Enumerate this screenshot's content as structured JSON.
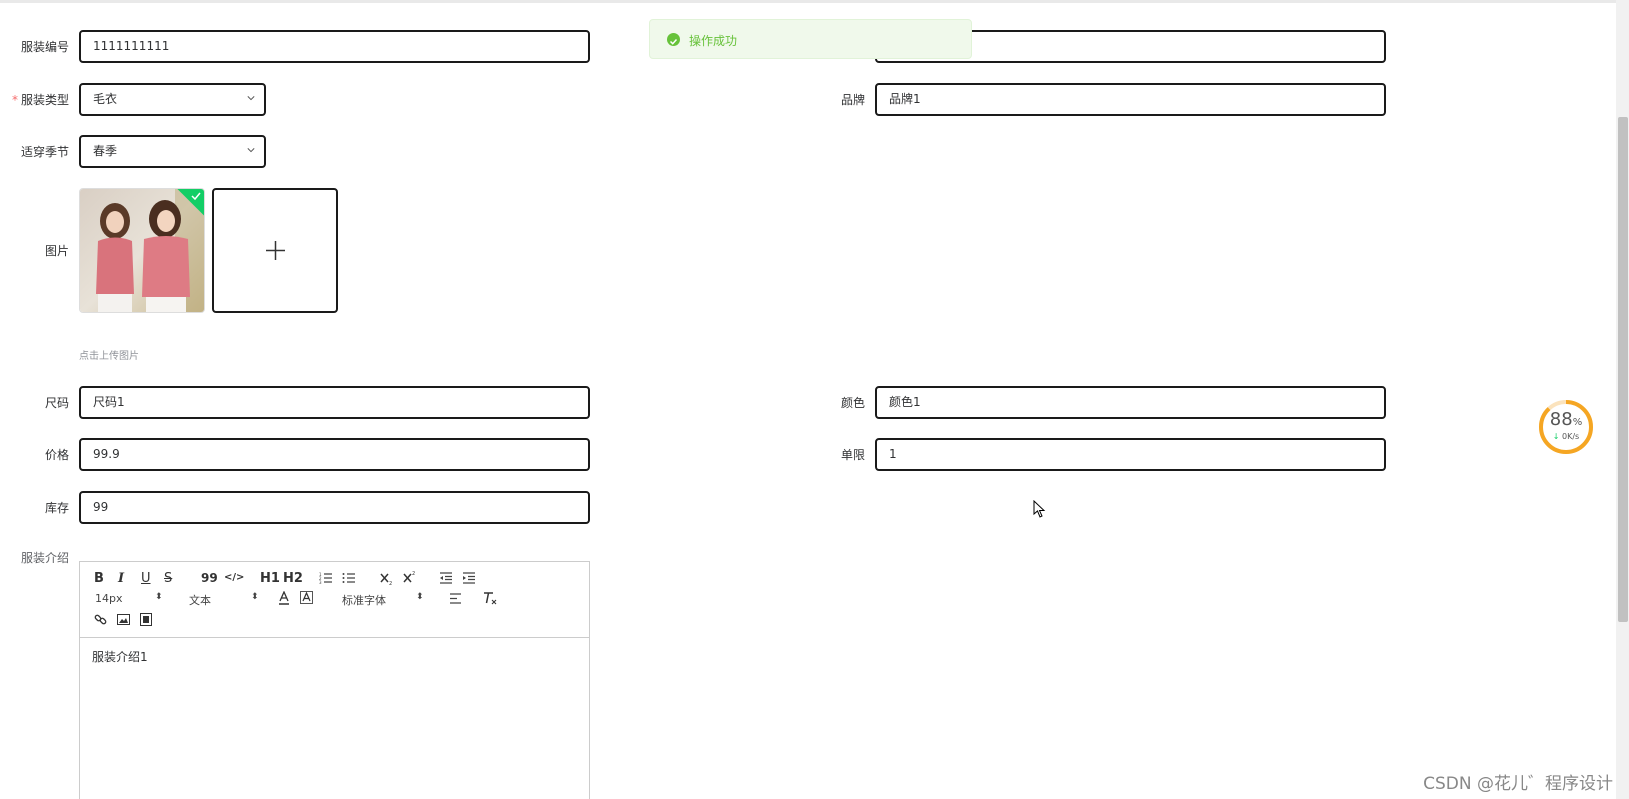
{
  "notification": {
    "message": "操作成功"
  },
  "form": {
    "garment_code": {
      "label": "服装编号",
      "value": "1111111111"
    },
    "garment_name": {
      "value": ""
    },
    "garment_type": {
      "label": "服装类型",
      "required_mark": "*",
      "value": "毛衣"
    },
    "brand": {
      "label": "品牌",
      "value": "品牌1"
    },
    "season": {
      "label": "适穿季节",
      "value": "春季"
    },
    "image": {
      "label": "图片",
      "upload_tip": "点击上传图片",
      "add_symbol": "+"
    },
    "size": {
      "label": "尺码",
      "value": "尺码1"
    },
    "color": {
      "label": "颜色",
      "value": "颜色1"
    },
    "price": {
      "label": "价格",
      "value": "99.9"
    },
    "limit": {
      "label": "单限",
      "value": "1"
    },
    "stock": {
      "label": "库存",
      "value": "99"
    },
    "description": {
      "label": "服装介绍",
      "content": "服装介绍1",
      "toolbar": {
        "bold": "B",
        "italic": "I",
        "underline": "U",
        "strike": "S",
        "quote": "99",
        "code": "</>",
        "h1": "H1",
        "h2": "H2",
        "font_size": "14px",
        "header_style": "文本",
        "font_family": "标准字体"
      }
    }
  },
  "download_meter": {
    "percent": "88",
    "percent_unit": "%",
    "speed": "0K/s"
  },
  "watermark": "CSDN @花儿゛程序设计"
}
